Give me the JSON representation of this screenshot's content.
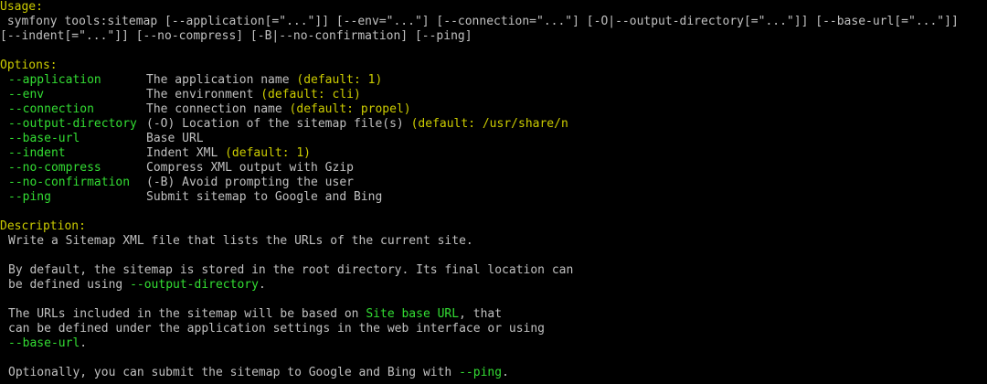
{
  "usage": {
    "heading": "Usage:",
    "line1": " symfony tools:sitemap [--application[=\"...\"]] [--env=\"...\"] [--connection=\"...\"] [-O|--output-directory[=\"...\"]] [--base-url[=\"...\"]]",
    "line2": "[--indent[=\"...\"]] [--no-compress] [-B|--no-confirmation] [--ping]"
  },
  "options": {
    "heading": "Options:",
    "items": [
      {
        "name": "--application",
        "desc": "The application name ",
        "default": "(default: 1)"
      },
      {
        "name": "--env",
        "desc": "The environment ",
        "default": "(default: cli)"
      },
      {
        "name": "--connection",
        "desc": "The connection name ",
        "default": "(default: propel)"
      },
      {
        "name": "--output-directory",
        "desc": "(-O) Location of the sitemap file(s) ",
        "default": "(default: /usr/share/n"
      },
      {
        "name": "--base-url",
        "desc": "Base URL",
        "default": ""
      },
      {
        "name": "--indent",
        "desc": "Indent XML ",
        "default": "(default: 1)"
      },
      {
        "name": "--no-compress",
        "desc": "Compress XML output with Gzip",
        "default": ""
      },
      {
        "name": "--no-confirmation",
        "desc": "(-B) Avoid prompting the user",
        "default": ""
      },
      {
        "name": "--ping",
        "desc": "Submit sitemap to Google and Bing",
        "default": ""
      }
    ]
  },
  "description": {
    "heading": "Description:",
    "p1": "Write a Sitemap XML file that lists the URLs of the current site.",
    "p2_line1": "By default, the sitemap is stored in the root directory. Its final location can",
    "p2_line2_pre": "be defined using ",
    "p2_line2_opt": "--output-directory",
    "p2_line2_post": ".",
    "p3_line1_pre": "The URLs included in the sitemap will be based on ",
    "p3_line1_hl": "Site base URL",
    "p3_line1_post": ", that",
    "p3_line2": "can be defined under the application settings in the web interface or using",
    "p3_line3_opt": "--base-url",
    "p3_line3_post": ".",
    "p4_pre": "Optionally, you can submit the sitemap to Google and Bing with ",
    "p4_opt": "--ping",
    "p4_post": "."
  },
  "colors": {
    "background": "#000000",
    "text": "#c0c0c0",
    "heading": "#cccc00",
    "option": "#33dd33"
  }
}
